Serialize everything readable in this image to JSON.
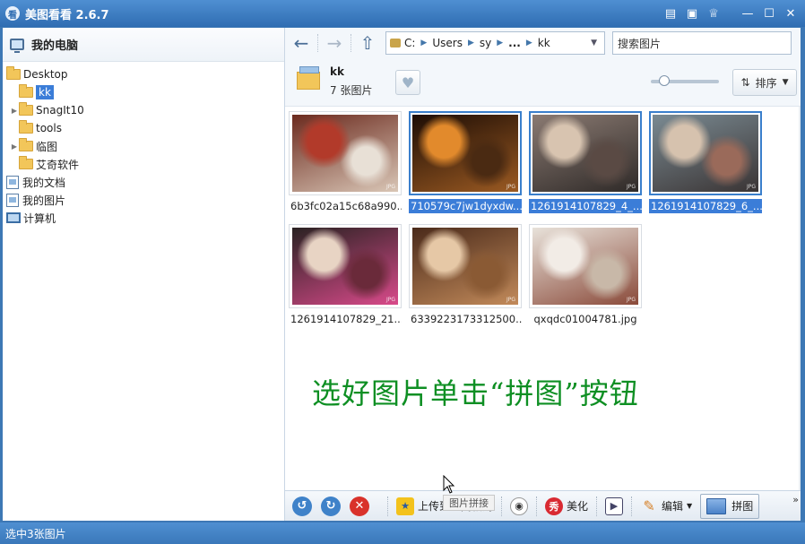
{
  "app": {
    "title": "美图看看 2.6.7",
    "icon_text": "看"
  },
  "window_controls": [
    "message-icon",
    "menu-icon",
    "skin-icon",
    "minimize-icon",
    "maximize-icon",
    "close-icon"
  ],
  "sidebar": {
    "header": "我的电脑",
    "items": [
      {
        "label": "Desktop",
        "level": 0,
        "expand": "",
        "icon": "folder-open-icon"
      },
      {
        "label": "kk",
        "level": 1,
        "expand": "",
        "icon": "folder-icon",
        "selected": true
      },
      {
        "label": "SnagIt10",
        "level": 1,
        "expand": "▶",
        "icon": "folder-icon"
      },
      {
        "label": "tools",
        "level": 1,
        "expand": "",
        "icon": "folder-icon"
      },
      {
        "label": "临图",
        "level": 1,
        "expand": "▶",
        "icon": "folder-icon"
      },
      {
        "label": "艾奇软件",
        "level": 1,
        "expand": "",
        "icon": "folder-icon"
      },
      {
        "label": "我的文档",
        "level": 0,
        "expand": "",
        "icon": "documents-icon"
      },
      {
        "label": "我的图片",
        "level": 0,
        "expand": "",
        "icon": "pictures-icon"
      },
      {
        "label": "计算机",
        "level": 0,
        "expand": "",
        "icon": "computer-icon"
      }
    ]
  },
  "nav": {
    "path": [
      "C:",
      "Users",
      "sy",
      "...",
      "kk"
    ],
    "search_value": "搜索图片"
  },
  "folder_info": {
    "name": "kk",
    "count": "7 张图片"
  },
  "zoom_level": 0.2,
  "sort_label": "排序",
  "thumbnails": [
    {
      "caption": "6b3fc02a15c68a990...",
      "selected": false,
      "palette": [
        "#6b2a1e",
        "#d9c6b6",
        "#b23a2a",
        "#e8e0d6"
      ]
    },
    {
      "caption": "710579c7jw1dyxdw...",
      "selected": true,
      "palette": [
        "#1d0d05",
        "#9b5a22",
        "#e28a2c",
        "#4a2a12"
      ]
    },
    {
      "caption": "1261914107829_4_...",
      "selected": true,
      "palette": [
        "#8a7a72",
        "#2f2a28",
        "#d8c4b0",
        "#5a4a44"
      ]
    },
    {
      "caption": "1261914107829_6_...",
      "selected": true,
      "palette": [
        "#7a8a92",
        "#3a3434",
        "#d6c2ae",
        "#9a6a5a"
      ]
    },
    {
      "caption": "1261914107829_21...",
      "selected": false,
      "palette": [
        "#2a2222",
        "#d84a8a",
        "#e8d4c4",
        "#6a2a3a"
      ]
    },
    {
      "caption": "6339223173312500...",
      "selected": false,
      "palette": [
        "#4a2a1a",
        "#c28a5a",
        "#e6c8a6",
        "#8a5a34"
      ]
    },
    {
      "caption": "qxqdc01004781.jpg",
      "selected": false,
      "palette": [
        "#e8e2da",
        "#8a4a3a",
        "#f2ece6",
        "#c8b8a8"
      ]
    }
  ],
  "instruction": "选好图片单击“拼图”按钮",
  "toolbar": {
    "upload_label": "上传到空间相册",
    "beautify_label": "美化",
    "edit_label": "编辑",
    "puzzle_label": "拼图",
    "puzzle_tooltip": "图片拼接",
    "more": "»"
  },
  "status": "选中3张图片",
  "colors": {
    "accent": "#3b7dd8",
    "instruction": "#0e8f23",
    "titlebar": "#2f6db2"
  }
}
